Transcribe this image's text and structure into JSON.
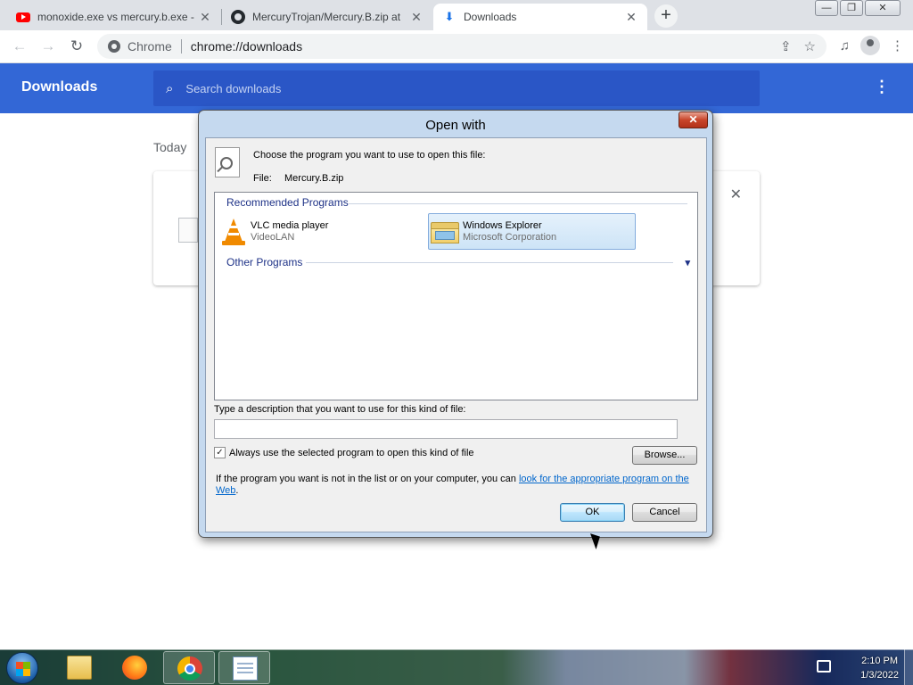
{
  "browser": {
    "tabs": [
      {
        "title": "monoxide.exe vs mercury.b.exe -",
        "icon": "youtube-icon",
        "close": "✕"
      },
      {
        "title": "MercuryTrojan/Mercury.B.zip at",
        "icon": "github-icon",
        "close": "✕"
      },
      {
        "title": "Downloads",
        "icon": "download-icon",
        "close": "✕"
      }
    ],
    "new_tab": "+",
    "window_buttons": {
      "minimize": "—",
      "restore": "❐",
      "close": "✕"
    },
    "omnibox": {
      "site": "Chrome",
      "url": "chrome://downloads"
    }
  },
  "downloads": {
    "title": "Downloads",
    "search_placeholder": "Search downloads",
    "section": "Today",
    "remove": "✕"
  },
  "dialog": {
    "title": "Open with",
    "close": "✕",
    "prompt": "Choose the program you want to use to open this file:",
    "file_label": "File:",
    "file_name": "Mercury.B.zip",
    "recommended_header": "Recommended Programs",
    "other_header": "Other Programs",
    "programs": [
      {
        "name": "VLC media player",
        "vendor": "VideoLAN",
        "selected": false
      },
      {
        "name": "Windows Explorer",
        "vendor": "Microsoft Corporation",
        "selected": true
      }
    ],
    "description_label": "Type a description that you want to use for this kind of file:",
    "description_value": "",
    "always_label": "Always use the selected program to open this kind of file",
    "always_checked": true,
    "browse_label": "Browse...",
    "web_note": "If the program you want is not in the list or on your computer, you can ",
    "web_link": "look for the appropriate program on the Web",
    "web_note_end": ".",
    "ok_label": "OK",
    "cancel_label": "Cancel"
  },
  "taskbar": {
    "time": "2:10 PM",
    "date": "1/3/2022",
    "items": [
      "folder-icon",
      "firefox-icon",
      "chrome-icon",
      "notepad-icon"
    ]
  }
}
